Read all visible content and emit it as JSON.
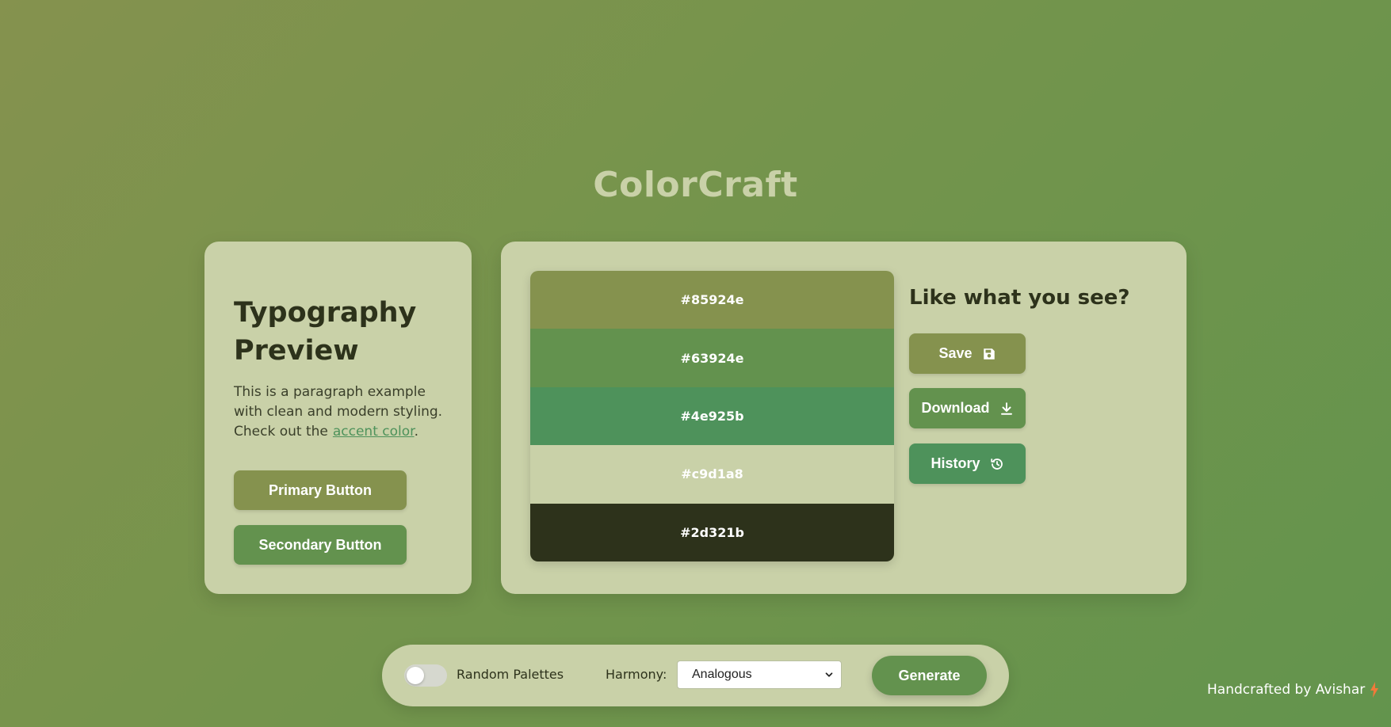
{
  "app": {
    "title": "ColorCraft"
  },
  "typography": {
    "heading": "Typography Preview",
    "paragraph_text": "This is a paragraph example with clean and modern styling. Check out the",
    "link_text": "accent color",
    "trailing_punct": ".",
    "primary_button": "Primary Button",
    "secondary_button": "Secondary Button"
  },
  "palette": {
    "swatches": [
      {
        "hex": "#85924e",
        "label": "#85924e"
      },
      {
        "hex": "#63924e",
        "label": "#63924e"
      },
      {
        "hex": "#4e925b",
        "label": "#4e925b"
      },
      {
        "hex": "#c9d1a8",
        "label": "#c9d1a8"
      },
      {
        "hex": "#2d321b",
        "label": "#2d321b"
      }
    ]
  },
  "actions": {
    "heading": "Like what you see?",
    "save_label": "Save",
    "save_icon": "floppy-disk-icon",
    "download_label": "Download",
    "download_icon": "download-icon",
    "history_label": "History",
    "history_icon": "history-clock-icon"
  },
  "controls": {
    "toggle_label": "Random Palettes",
    "toggle_on": false,
    "harmony_label": "Harmony:",
    "harmony_value": "Analogous",
    "generate_label": "Generate"
  },
  "footer": {
    "text": "Handcrafted by Avishar",
    "icon": "lightning-bolt-icon",
    "icon_color": "#f07a3a"
  }
}
